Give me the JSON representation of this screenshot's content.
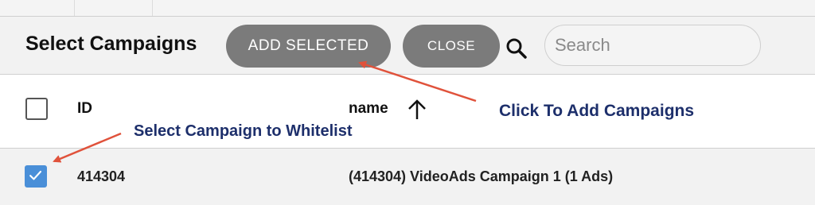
{
  "toolbar": {
    "title": "Select Campaigns",
    "add_selected_label": "ADD SELECTED",
    "close_label": "CLOSE",
    "search_placeholder": "Search"
  },
  "table": {
    "columns": {
      "id": "ID",
      "name": "name"
    },
    "sort_icon": "arrow-up-icon",
    "rows": [
      {
        "id": "414304",
        "name": "(414304) VideoAds Campaign 1 (1 Ads)",
        "selected": true
      }
    ]
  },
  "annotations": {
    "add_hint": "Click To Add Campaigns",
    "select_hint": "Select Campaign to Whitelist"
  },
  "colors": {
    "button_bg": "#7b7b7b",
    "checkbox_checked": "#4a8fd8",
    "annotation_text": "#1d2f6b",
    "arrow": "#e0523b"
  }
}
